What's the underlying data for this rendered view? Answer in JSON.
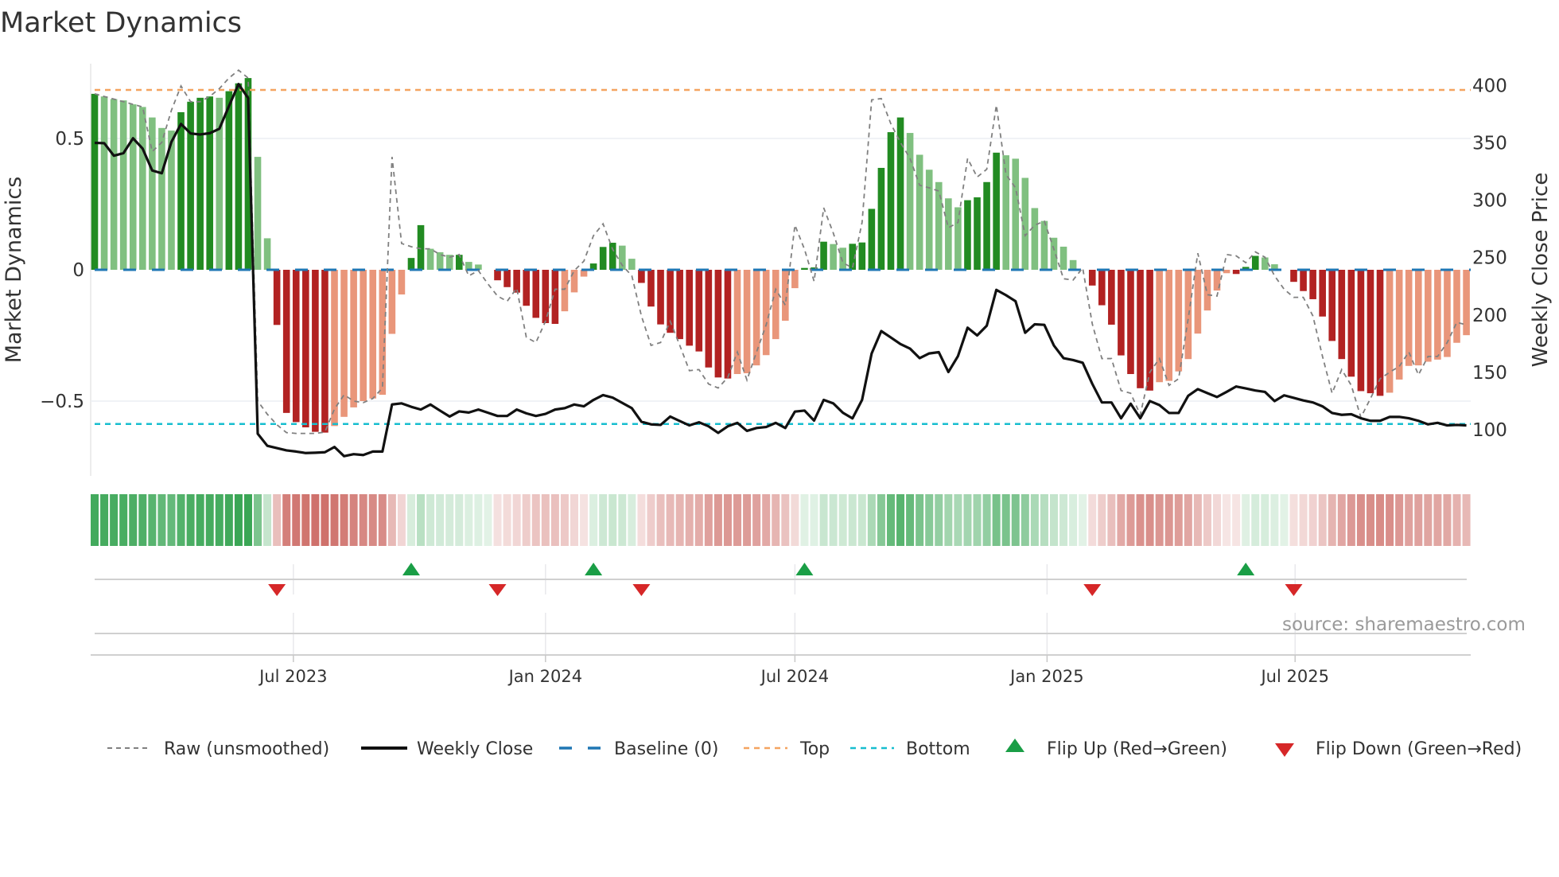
{
  "chart_data": {
    "type": "bar",
    "title": "Market Dynamics",
    "ylabel_left": "Market Dynamics",
    "ylabel_right": "Weekly Close Price",
    "start_date": "2023-02-06",
    "frequency": "weekly",
    "left_ylim": [
      -0.785,
      0.785
    ],
    "right_ylim": [
      60,
      419
    ],
    "left_ticks": [
      {
        "value": 0.5,
        "label": "0.5"
      },
      {
        "value": 0,
        "label": "0"
      },
      {
        "value": -0.5,
        "label": "−0.5"
      }
    ],
    "right_ticks": [
      {
        "value": 100,
        "label": "100"
      },
      {
        "value": 150,
        "label": "150"
      },
      {
        "value": 200,
        "label": "200"
      },
      {
        "value": 250,
        "label": "250"
      },
      {
        "value": 300,
        "label": "300"
      },
      {
        "value": 350,
        "label": "350"
      },
      {
        "value": 400,
        "label": "400"
      }
    ],
    "grid": true,
    "thresholds": {
      "top": 0.685,
      "bottom": -0.587,
      "baseline": 0
    },
    "xticks": [
      {
        "date": "2023-07-01",
        "label": "Jul 2023"
      },
      {
        "date": "2024-01-01",
        "label": "Jan 2024"
      },
      {
        "date": "2024-07-01",
        "label": "Jul 2024"
      },
      {
        "date": "2025-01-01",
        "label": "Jan 2025"
      },
      {
        "date": "2025-07-01",
        "label": "Jul 2025"
      }
    ],
    "series": [
      {
        "name": "Market Dynamics",
        "axis": "left",
        "values": [
          0.67,
          0.66,
          0.65,
          0.645,
          0.63,
          0.62,
          0.58,
          0.54,
          0.53,
          0.6,
          0.64,
          0.655,
          0.66,
          0.655,
          0.68,
          0.71,
          0.73,
          0.43,
          0.12,
          -0.21,
          -0.545,
          -0.58,
          -0.6,
          -0.617,
          -0.62,
          -0.595,
          -0.56,
          -0.524,
          -0.5,
          -0.49,
          -0.476,
          -0.244,
          -0.094,
          0.045,
          0.17,
          0.08,
          0.067,
          0.057,
          0.057,
          0.03,
          0.02,
          0,
          -0.04,
          -0.066,
          -0.087,
          -0.137,
          -0.183,
          -0.203,
          -0.206,
          -0.158,
          -0.086,
          -0.026,
          0.024,
          0.087,
          0.103,
          0.092,
          0.042,
          -0.05,
          -0.14,
          -0.208,
          -0.24,
          -0.264,
          -0.289,
          -0.311,
          -0.372,
          -0.41,
          -0.414,
          -0.397,
          -0.394,
          -0.364,
          -0.325,
          -0.264,
          -0.194,
          -0.07,
          0.007,
          0.009,
          0.107,
          0.098,
          0.084,
          0.099,
          0.104,
          0.232,
          0.388,
          0.524,
          0.58,
          0.521,
          0.438,
          0.381,
          0.334,
          0.272,
          0.238,
          0.265,
          0.276,
          0.334,
          0.446,
          0.436,
          0.423,
          0.35,
          0.235,
          0.186,
          0.122,
          0.088,
          0.037,
          0,
          -0.06,
          -0.135,
          -0.209,
          -0.326,
          -0.397,
          -0.451,
          -0.46,
          -0.428,
          -0.423,
          -0.387,
          -0.34,
          -0.243,
          -0.155,
          -0.079,
          -0.013,
          -0.016,
          0.011,
          0.053,
          0.047,
          0.021,
          0,
          -0.046,
          -0.081,
          -0.112,
          -0.178,
          -0.271,
          -0.34,
          -0.407,
          -0.462,
          -0.47,
          -0.48,
          -0.468,
          -0.418,
          -0.366,
          -0.364,
          -0.35,
          -0.342,
          -0.332,
          -0.278,
          -0.249
        ]
      },
      {
        "name": "Raw (unsmoothed)",
        "axis": "left",
        "values": [
          0.67,
          0.66,
          0.65,
          0.64,
          0.63,
          0.62,
          0.45,
          0.485,
          0.607,
          0.7,
          0.64,
          0.64,
          0.66,
          0.69,
          0.73,
          0.76,
          0.73,
          -0.5,
          -0.55,
          -0.59,
          -0.62,
          -0.623,
          -0.623,
          -0.623,
          -0.618,
          -0.53,
          -0.476,
          -0.5,
          -0.506,
          -0.49,
          -0.45,
          0.43,
          0.1,
          0.088,
          0.08,
          0.08,
          0.058,
          0.048,
          0.058,
          -0.023,
          -0.003,
          -0.054,
          -0.1,
          -0.12,
          -0.07,
          -0.257,
          -0.277,
          -0.196,
          -0.074,
          -0.074,
          -0.003,
          0.033,
          0.13,
          0.175,
          0.078,
          0.017,
          -0.023,
          -0.176,
          -0.288,
          -0.277,
          -0.196,
          -0.288,
          -0.384,
          -0.38,
          -0.435,
          -0.45,
          -0.41,
          -0.313,
          -0.42,
          -0.313,
          -0.21,
          -0.074,
          -0.135,
          0.17,
          0.078,
          -0.044,
          0.236,
          0.14,
          0.027,
          0.007,
          0.18,
          0.647,
          0.652,
          0.556,
          0.485,
          0.424,
          0.322,
          0.312,
          0.3,
          0.16,
          0.18,
          0.424,
          0.353,
          0.383,
          0.627,
          0.363,
          0.312,
          0.13,
          0.17,
          0.185,
          0.078,
          -0.034,
          -0.039,
          0.007,
          -0.206,
          -0.338,
          -0.338,
          -0.46,
          -0.47,
          -0.552,
          -0.39,
          -0.338,
          -0.44,
          -0.415,
          -0.186,
          0.063,
          -0.095,
          -0.1,
          0.058,
          0.053,
          0.027,
          0.068,
          0.048,
          -0.023,
          -0.074,
          -0.105,
          -0.105,
          -0.176,
          -0.33,
          -0.47,
          -0.38,
          -0.44,
          -0.562,
          -0.49,
          -0.415,
          -0.39,
          -0.368,
          -0.313,
          -0.4,
          -0.33,
          -0.33,
          -0.277,
          -0.2,
          -0.21
        ]
      },
      {
        "name": "Weekly Close",
        "axis": "right",
        "values": [
          350,
          349.7,
          338.8,
          341,
          354,
          345,
          325.9,
          323.5,
          350.8,
          366.5,
          358.2,
          357.3,
          358.4,
          362.3,
          382,
          401.2,
          389,
          96.5,
          86,
          84,
          82,
          81,
          79.7,
          80,
          80.4,
          85,
          77,
          78.7,
          78,
          81,
          81,
          122,
          123,
          120,
          117.6,
          122,
          116.7,
          111.5,
          116,
          115,
          117.6,
          114.8,
          112,
          112,
          117.6,
          114.3,
          112,
          113.8,
          117.6,
          118.8,
          122,
          120.4,
          126,
          130.2,
          128,
          123.4,
          118.8,
          107,
          104.7,
          104.2,
          111.5,
          107.6,
          103.8,
          106.5,
          103,
          97.3,
          103,
          106,
          99,
          101.5,
          102.4,
          106,
          101.5,
          115.8,
          116.7,
          108,
          126,
          123,
          114.8,
          109.9,
          126,
          166.5,
          186,
          180.4,
          174.7,
          170.7,
          162.4,
          166.5,
          167.6,
          150.3,
          164.2,
          188.9,
          182.2,
          190.7,
          221.9,
          217.3,
          212,
          184.5,
          191.9,
          191.4,
          173.4,
          162.4,
          160.7,
          158.4,
          140,
          123.8,
          123.8,
          110,
          122.7,
          110,
          125,
          121.5,
          114.6,
          114.6,
          129.6,
          135.4,
          131.9,
          128.5,
          133,
          137.7,
          136,
          134.2,
          133,
          125,
          130,
          127.8,
          125.5,
          123.8,
          120.4,
          114.6,
          113,
          113.5,
          110,
          107.8,
          107.8,
          111.2,
          111.2,
          110,
          107.8,
          104.7,
          106,
          103.8,
          104.2,
          103.8
        ]
      }
    ],
    "flip_up_weeks": [
      34,
      53,
      75,
      121
    ],
    "flip_down_weeks": [
      20,
      43,
      58,
      105,
      126
    ],
    "legend_position": "bottom",
    "legend": [
      {
        "label": "Raw (unsmoothed)"
      },
      {
        "label": "Weekly Close"
      },
      {
        "label": "Baseline (0)"
      },
      {
        "label": "Top"
      },
      {
        "label": "Bottom"
      },
      {
        "label": "Flip Up (Red→Green)"
      },
      {
        "label": "Flip Down (Green→Red)"
      }
    ],
    "source": "source: sharemaestro.com"
  },
  "colors": {
    "rising_green": "#228b22",
    "falling_green": "#80c080",
    "falling_red": "#b22222",
    "rising_red": "#e9967a",
    "strip_green": "#3aa655",
    "strip_red": "#c9605a",
    "raw": "#808080",
    "close": "#111111",
    "baseline": "#1f77b4",
    "top": "#f4a460",
    "bottom": "#17becf",
    "flip_up": "#1a9e46",
    "flip_down": "#d62728"
  }
}
